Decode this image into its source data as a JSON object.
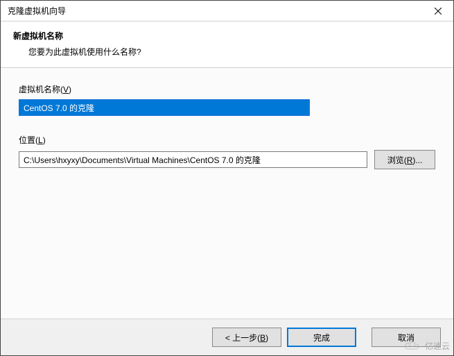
{
  "window": {
    "title": "克隆虚拟机向导"
  },
  "header": {
    "title": "新虚拟机名称",
    "subtitle": "您要为此虚拟机使用什么名称?"
  },
  "fields": {
    "name": {
      "label_prefix": "虚拟机名称(",
      "accel": "V",
      "label_suffix": ")",
      "value": "CentOS 7.0 的克隆"
    },
    "location": {
      "label_prefix": "位置(",
      "accel": "L",
      "label_suffix": ")",
      "value": "C:\\Users\\hxyxy\\Documents\\Virtual Machines\\CentOS 7.0 的克隆"
    }
  },
  "buttons": {
    "browse_prefix": "浏览(",
    "browse_accel": "R",
    "browse_suffix": ")...",
    "back_prefix": "< 上一步(",
    "back_accel": "B",
    "back_suffix": ")",
    "finish": "完成",
    "cancel": "取消"
  },
  "watermark": {
    "text": "亿速云"
  }
}
